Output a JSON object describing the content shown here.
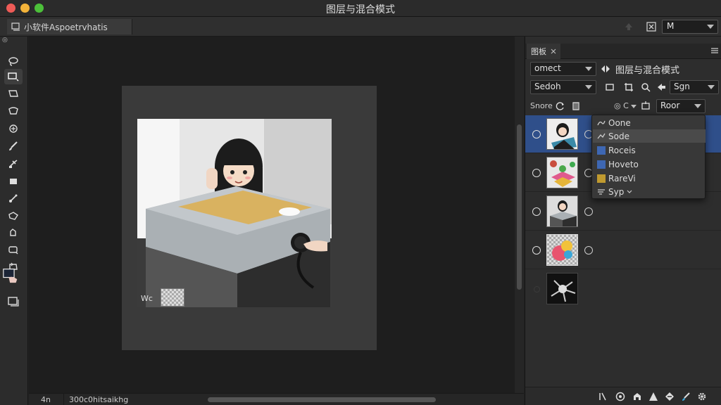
{
  "window": {
    "title": "图层与混合模式"
  },
  "options_bar": {
    "doc_tab": "小软件Aspoetrvhatis",
    "mode_value": "M"
  },
  "toolbar": {
    "top_mark": "◎",
    "tools": [
      "lasso-icon",
      "marquee-icon",
      "quick-select-icon",
      "crop-icon",
      "heal-icon",
      "brush-icon",
      "clone-stamp-icon",
      "eraser-icon",
      "pen-icon",
      "shape-icon",
      "hand-icon",
      "zoom-icon",
      "rotate-icon",
      "color-swatch-icon",
      "quick-mask-icon"
    ]
  },
  "canvas": {
    "small_label": "Wc"
  },
  "status": {
    "zoom": "4n",
    "doc_info": "300c0hitsaikhg"
  },
  "panel": {
    "tab_label": "图板",
    "select_1": "omect",
    "blend_title": "图层与混合模式",
    "select_2": "Sedoh",
    "select_3": "Sgn",
    "row3_label": "Snore",
    "row3_small": "◎ C",
    "select_4": "Roor"
  },
  "dropdown": {
    "items": [
      {
        "label": "Oone",
        "icon": "curve-icon"
      },
      {
        "label": "Sode",
        "icon": "check-icon"
      },
      {
        "label": "Roceis",
        "swatch": "#3e67b3"
      },
      {
        "label": "Hoveto",
        "swatch": "#3e67b3"
      },
      {
        "label": "RareVi",
        "swatch": "#c09a2f"
      },
      {
        "label": "Syp",
        "icon": "lines-icon"
      }
    ]
  },
  "colors": {
    "selected_row": "#2f4f8a",
    "accent_blue": "#3e67b3"
  }
}
